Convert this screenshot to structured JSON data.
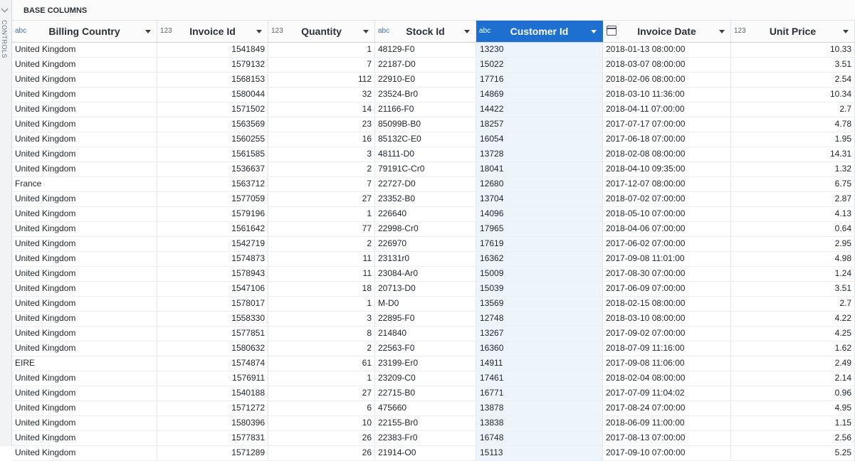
{
  "sidebar": {
    "label": "CONTROLS"
  },
  "group_label": "BASE COLUMNS",
  "columns": [
    {
      "type": "abc",
      "name": "Billing Country",
      "icon": "text-type-icon"
    },
    {
      "type": "123",
      "name": "Invoice Id",
      "icon": "number-type-icon"
    },
    {
      "type": "123",
      "name": "Quantity",
      "icon": "number-type-icon"
    },
    {
      "type": "abc",
      "name": "Stock Id",
      "icon": "text-type-icon"
    },
    {
      "type": "abc",
      "name": "Customer Id",
      "icon": "text-type-icon",
      "selected": true
    },
    {
      "type": "",
      "name": "Invoice Date",
      "icon": "calendar-icon"
    },
    {
      "type": "123",
      "name": "Unit Price",
      "icon": "number-type-icon"
    }
  ],
  "rows": [
    [
      "United Kingdom",
      "1541849",
      "1",
      "48129-F0",
      "13230",
      "2018-01-13 08:00:00",
      "10.33"
    ],
    [
      "United Kingdom",
      "1579132",
      "7",
      "22187-D0",
      "15022",
      "2018-03-07 08:00:00",
      "3.51"
    ],
    [
      "United Kingdom",
      "1568153",
      "112",
      "22910-E0",
      "17716",
      "2018-02-06 08:00:00",
      "2.54"
    ],
    [
      "United Kingdom",
      "1580044",
      "32",
      "23524-Br0",
      "14869",
      "2018-03-10 11:36:00",
      "10.34"
    ],
    [
      "United Kingdom",
      "1571502",
      "14",
      "21166-F0",
      "14422",
      "2018-04-11 07:00:00",
      "2.7"
    ],
    [
      "United Kingdom",
      "1563569",
      "23",
      "85099B-B0",
      "18257",
      "2017-07-17 07:00:00",
      "4.78"
    ],
    [
      "United Kingdom",
      "1560255",
      "16",
      "85132C-E0",
      "16054",
      "2017-06-18 07:00:00",
      "1.95"
    ],
    [
      "United Kingdom",
      "1561585",
      "3",
      "48111-D0",
      "13728",
      "2018-02-08 08:00:00",
      "14.31"
    ],
    [
      "United Kingdom",
      "1536637",
      "2",
      "79191C-Cr0",
      "18041",
      "2018-04-10 09:35:00",
      "1.32"
    ],
    [
      "France",
      "1563712",
      "7",
      "22727-D0",
      "12680",
      "2017-12-07 08:00:00",
      "6.75"
    ],
    [
      "United Kingdom",
      "1577059",
      "27",
      "23352-B0",
      "13704",
      "2018-07-02 07:00:00",
      "2.87"
    ],
    [
      "United Kingdom",
      "1579196",
      "1",
      "226640",
      "14096",
      "2018-05-10 07:00:00",
      "4.13"
    ],
    [
      "United Kingdom",
      "1561642",
      "77",
      "22998-Cr0",
      "17965",
      "2018-04-06 07:00:00",
      "0.64"
    ],
    [
      "United Kingdom",
      "1542719",
      "2",
      "226970",
      "17619",
      "2017-06-02 07:00:00",
      "2.95"
    ],
    [
      "United Kingdom",
      "1574873",
      "11",
      "23131r0",
      "16362",
      "2017-09-08 11:01:00",
      "4.98"
    ],
    [
      "United Kingdom",
      "1578943",
      "11",
      "23084-Ar0",
      "15009",
      "2017-08-30 07:00:00",
      "1.24"
    ],
    [
      "United Kingdom",
      "1547106",
      "18",
      "20713-D0",
      "15039",
      "2017-06-09 07:00:00",
      "3.51"
    ],
    [
      "United Kingdom",
      "1578017",
      "1",
      "M-D0",
      "13569",
      "2018-02-15 08:00:00",
      "2.7"
    ],
    [
      "United Kingdom",
      "1558330",
      "3",
      "22895-F0",
      "12748",
      "2018-03-10 08:00:00",
      "4.22"
    ],
    [
      "United Kingdom",
      "1577851",
      "8",
      "214840",
      "13267",
      "2017-09-02 07:00:00",
      "4.25"
    ],
    [
      "United Kingdom",
      "1580632",
      "2",
      "22563-F0",
      "16360",
      "2018-07-09 11:16:00",
      "1.62"
    ],
    [
      "EIRE",
      "1574874",
      "61",
      "23199-Er0",
      "14911",
      "2017-09-08 11:06:00",
      "2.49"
    ],
    [
      "United Kingdom",
      "1576911",
      "1",
      "23209-C0",
      "17461",
      "2018-02-04 08:00:00",
      "2.14"
    ],
    [
      "United Kingdom",
      "1540188",
      "27",
      "22715-B0",
      "16771",
      "2017-07-09 11:04:02",
      "0.96"
    ],
    [
      "United Kingdom",
      "1571272",
      "6",
      "475660",
      "13878",
      "2017-08-24 07:00:00",
      "4.95"
    ],
    [
      "United Kingdom",
      "1580396",
      "10",
      "22155-Br0",
      "13838",
      "2018-06-09 11:00:00",
      "1.15"
    ],
    [
      "United Kingdom",
      "1577831",
      "26",
      "22383-Fr0",
      "16748",
      "2017-08-13 07:00:00",
      "2.56"
    ],
    [
      "United Kingdom",
      "1571289",
      "26",
      "21914-O0",
      "15113",
      "2017-09-10 07:00:00",
      "5.25"
    ]
  ]
}
